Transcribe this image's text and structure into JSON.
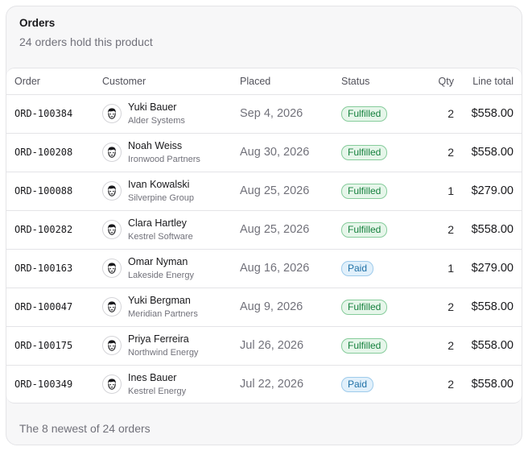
{
  "card": {
    "title": "Orders",
    "subtitle": "24 orders hold this product",
    "footer": "The 8 newest of 24 orders"
  },
  "columns": {
    "order": "Order",
    "customer": "Customer",
    "placed": "Placed",
    "status": "Status",
    "qty": "Qty",
    "total": "Line total"
  },
  "status_colors": {
    "Fulfilled": "#15803d",
    "Paid": "#1d6fa5"
  },
  "rows": [
    {
      "order": "ORD-100384",
      "name": "Yuki Bauer",
      "company": "Alder Systems",
      "placed": "Sep 4, 2026",
      "status": "Fulfilled",
      "qty": "2",
      "total": "$558.00",
      "avatar_icon": "person-avatar-icon"
    },
    {
      "order": "ORD-100208",
      "name": "Noah Weiss",
      "company": "Ironwood Partners",
      "placed": "Aug 30, 2026",
      "status": "Fulfilled",
      "qty": "2",
      "total": "$558.00",
      "avatar_icon": "person-avatar-icon"
    },
    {
      "order": "ORD-100088",
      "name": "Ivan Kowalski",
      "company": "Silverpine Group",
      "placed": "Aug 25, 2026",
      "status": "Fulfilled",
      "qty": "1",
      "total": "$279.00",
      "avatar_icon": "person-avatar-icon"
    },
    {
      "order": "ORD-100282",
      "name": "Clara Hartley",
      "company": "Kestrel Software",
      "placed": "Aug 25, 2026",
      "status": "Fulfilled",
      "qty": "2",
      "total": "$558.00",
      "avatar_icon": "person-avatar-icon"
    },
    {
      "order": "ORD-100163",
      "name": "Omar Nyman",
      "company": "Lakeside Energy",
      "placed": "Aug 16, 2026",
      "status": "Paid",
      "qty": "1",
      "total": "$279.00",
      "avatar_icon": "person-avatar-icon"
    },
    {
      "order": "ORD-100047",
      "name": "Yuki Bergman",
      "company": "Meridian Partners",
      "placed": "Aug 9, 2026",
      "status": "Fulfilled",
      "qty": "2",
      "total": "$558.00",
      "avatar_icon": "person-avatar-icon"
    },
    {
      "order": "ORD-100175",
      "name": "Priya Ferreira",
      "company": "Northwind Energy",
      "placed": "Jul 26, 2026",
      "status": "Fulfilled",
      "qty": "2",
      "total": "$558.00",
      "avatar_icon": "person-avatar-icon"
    },
    {
      "order": "ORD-100349",
      "name": "Ines Bauer",
      "company": "Kestrel Energy",
      "placed": "Jul 22, 2026",
      "status": "Paid",
      "qty": "2",
      "total": "$558.00",
      "avatar_icon": "person-avatar-icon"
    }
  ]
}
